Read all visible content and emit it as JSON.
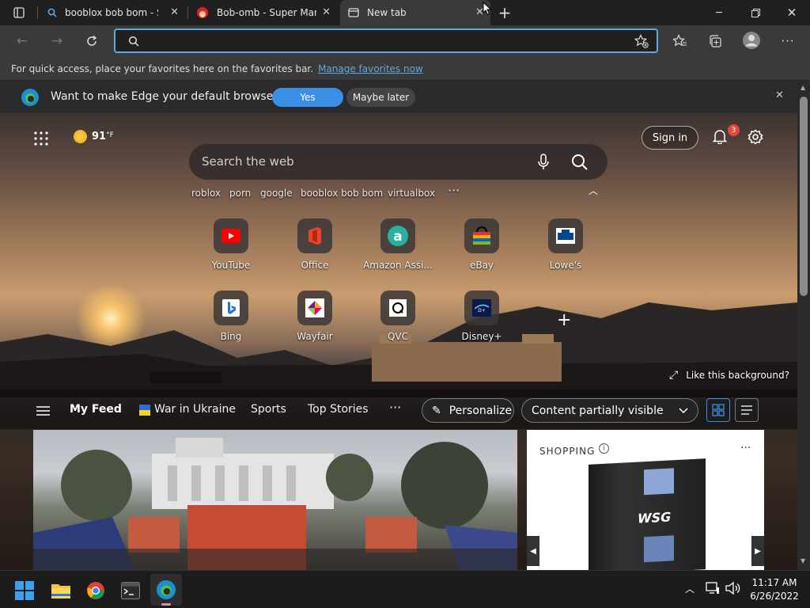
{
  "tabs": [
    {
      "title": "booblox bob bom - Search"
    },
    {
      "title": "Bob-omb - Super Mario Wiki"
    },
    {
      "title": "New tab"
    }
  ],
  "address": {
    "value": ""
  },
  "favbar": {
    "text": "For quick access, place your favorites here on the favorites bar.",
    "link": "Manage favorites now"
  },
  "infobar": {
    "text": "Want to make Edge your default browser?",
    "yes": "Yes",
    "later": "Maybe later"
  },
  "weather": {
    "temp": "91",
    "unit": "°F"
  },
  "signin": "Sign in",
  "notifications": {
    "count": "3"
  },
  "search": {
    "placeholder": "Search the web"
  },
  "suggestions": [
    "roblox",
    "porn",
    "google",
    "booblox bob bom",
    "virtualbox"
  ],
  "tiles": [
    {
      "label": "YouTube",
      "icon": "youtube-icon"
    },
    {
      "label": "Office",
      "icon": "office-icon"
    },
    {
      "label": "Amazon Assi...",
      "icon": "amazon-icon"
    },
    {
      "label": "eBay",
      "icon": "ebay-icon"
    },
    {
      "label": "Lowe's",
      "icon": "lowes-icon"
    },
    {
      "label": "Bing",
      "icon": "bing-icon"
    },
    {
      "label": "Wayfair",
      "icon": "wayfair-icon"
    },
    {
      "label": "QVC",
      "icon": "qvc-icon"
    },
    {
      "label": "Disney+",
      "icon": "disney-icon"
    }
  ],
  "background_link": "Like this background?",
  "feed_nav": {
    "my_feed": "My Feed",
    "ukraine": "War in Ukraine",
    "sports": "Sports",
    "top_stories": "Top Stories",
    "personalize": "Personalize",
    "content": "Content partially visible"
  },
  "shopping": {
    "title": "SHOPPING",
    "product_brand": "WSG"
  },
  "taskbar": {
    "time": "11:17 AM",
    "date": "6/26/2022"
  },
  "colors": {
    "accent": "#3a8ee6",
    "link": "#5ea8e0",
    "badge": "#e4483c"
  }
}
